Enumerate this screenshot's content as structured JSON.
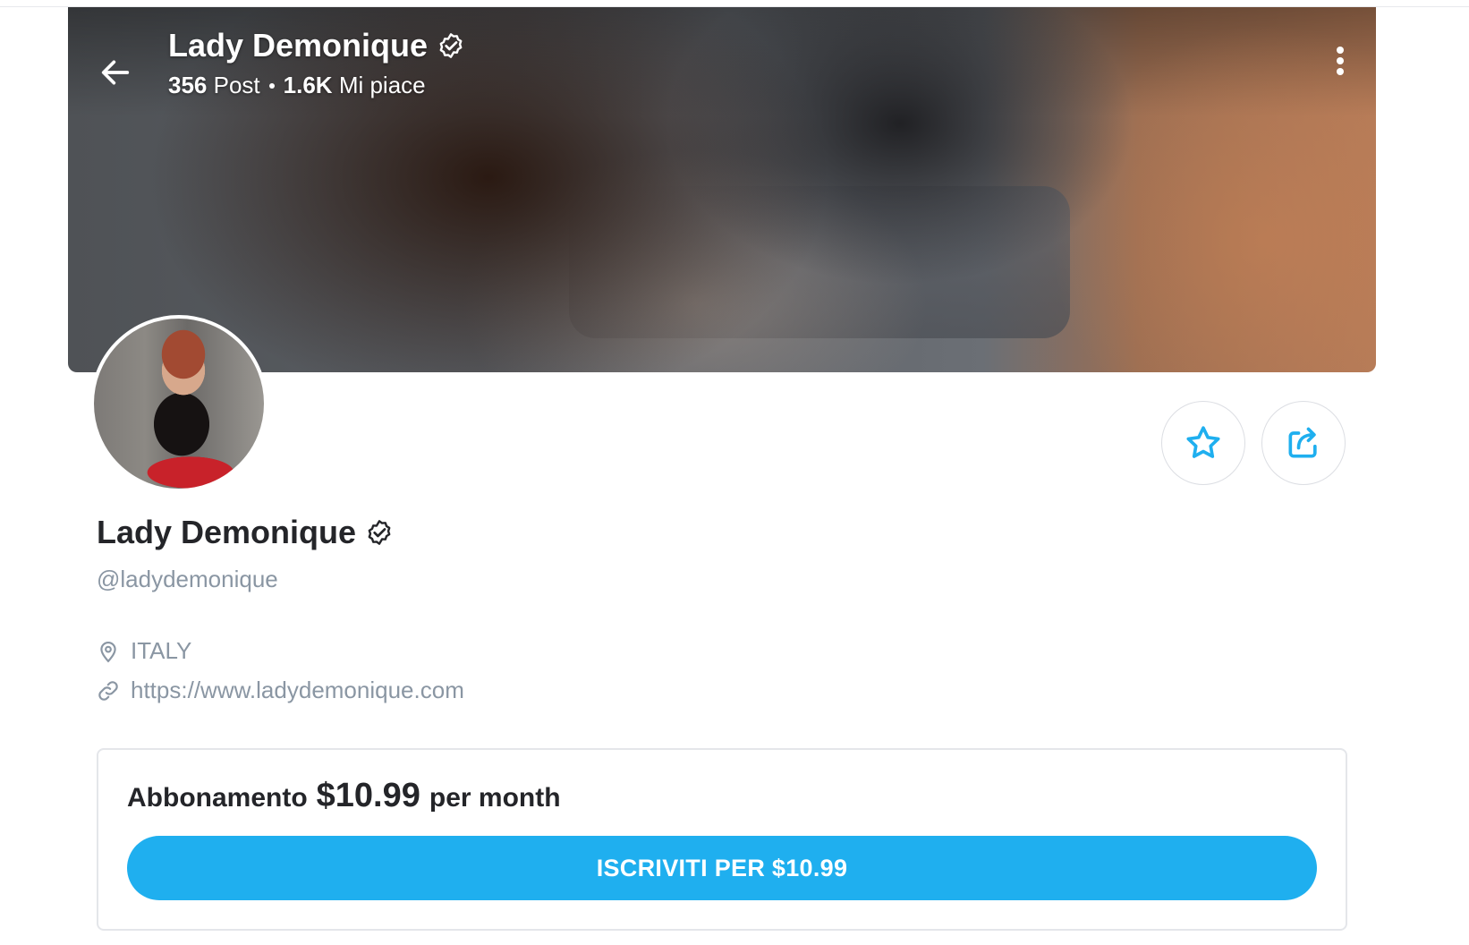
{
  "cover": {
    "title": "Lady Demonique",
    "posts_count": "356",
    "posts_label": "Post",
    "likes_count": "1.6K",
    "likes_label": "Mi piace"
  },
  "profile": {
    "name": "Lady Demonique",
    "username": "@ladydemonique",
    "location": "ITALY",
    "website": "https://www.ladydemonique.com"
  },
  "subscription": {
    "label": "Abbonamento",
    "price": "$10.99",
    "period": "per month",
    "button_label": "ISCRIVITI PER $10.99"
  },
  "colors": {
    "accent": "#1fafef",
    "muted_text": "#8a96a3",
    "primary_text": "#242529"
  },
  "icons": [
    "back-arrow-icon",
    "verified-icon",
    "more-vertical-icon",
    "star-icon",
    "share-icon",
    "location-pin-icon",
    "link-icon"
  ]
}
